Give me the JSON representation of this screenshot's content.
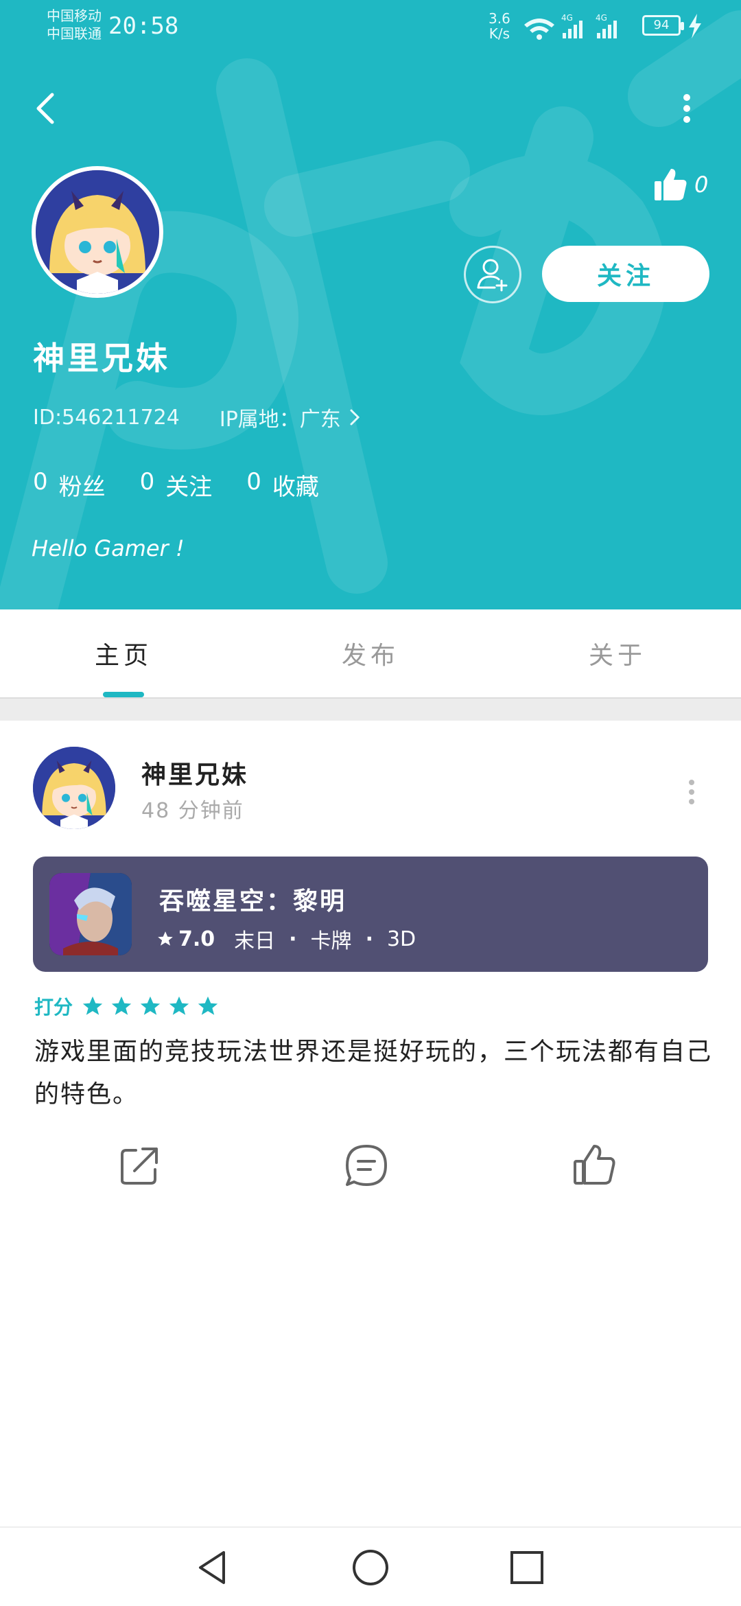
{
  "status_bar": {
    "carrier_1": "中国移动",
    "carrier_2": "中国联通",
    "time": "20:58",
    "net_speed_value": "3.6",
    "net_speed_unit": "K/s",
    "battery": "94",
    "network_label": "4G"
  },
  "profile": {
    "likes": "0",
    "name": "神里兄妹",
    "id_text": "ID:546211724",
    "ip_text": "IP属地：广东",
    "follow_label": "关注",
    "stats": [
      {
        "count": "0",
        "label": "粉丝"
      },
      {
        "count": "0",
        "label": "关注"
      },
      {
        "count": "0",
        "label": "收藏"
      }
    ],
    "bio": "Hello Gamer !"
  },
  "tabs": [
    {
      "label": "主页",
      "active": true
    },
    {
      "label": "发布",
      "active": false
    },
    {
      "label": "关于",
      "active": false
    }
  ],
  "post": {
    "author": "神里兄妹",
    "time": "48 分钟前",
    "game": {
      "title": "吞噬星空：黎明",
      "score": "7.0",
      "tags": [
        "末日",
        "卡牌",
        "3D"
      ]
    },
    "rating_label": "打分",
    "rating_stars": 5,
    "text": "游戏里面的竞技玩法世界还是挺好玩的，三个玩法都有自己的特色。"
  },
  "colors": {
    "accent": "#1fb8c3",
    "game_card": "#515073",
    "tab_inactive": "#999999"
  },
  "icons": {
    "back": "chevron-left-icon",
    "more": "more-vertical-icon",
    "like": "thumbs-up-icon",
    "add_friend": "user-plus-icon",
    "share": "share-icon",
    "comment": "comment-icon",
    "star": "star-icon"
  }
}
